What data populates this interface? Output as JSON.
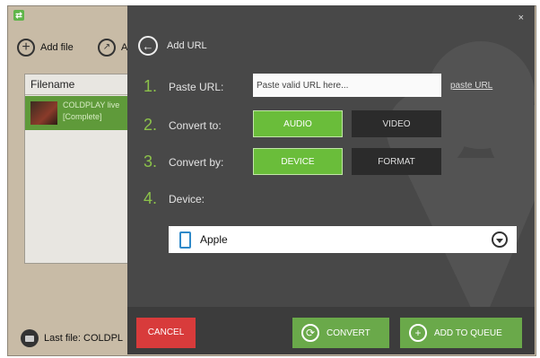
{
  "app": {
    "logo_glyph": "⇄",
    "toolbar": {
      "add_file_label": "Add file",
      "share_label": "A"
    },
    "file_list": {
      "header": "Filename",
      "items": [
        {
          "name": "COLDPLAY live",
          "status": "[Complete]"
        }
      ]
    },
    "footer": {
      "last_file_label": "Last file: COLDPL"
    }
  },
  "dialog": {
    "close_glyph": "×",
    "back_glyph": "←",
    "title": "Add URL",
    "steps": [
      {
        "number": "1.",
        "label": "Paste URL:"
      },
      {
        "number": "2.",
        "label": "Convert to:"
      },
      {
        "number": "3.",
        "label": "Convert by:"
      },
      {
        "number": "4.",
        "label": "Device:"
      }
    ],
    "url_input": {
      "value": "",
      "placeholder": "Paste valid URL here..."
    },
    "paste_url_link": "paste URL",
    "convert_to": {
      "options": [
        "AUDIO",
        "VIDEO"
      ],
      "selected": "AUDIO"
    },
    "convert_by": {
      "options": [
        "DEVICE",
        "FORMAT"
      ],
      "selected": "DEVICE"
    },
    "device": {
      "selected": "Apple",
      "icon": "phone-icon"
    },
    "footer": {
      "cancel_label": "CANCEL",
      "convert_label": "CONVERT",
      "add_to_queue_label": "ADD TO QUEUE"
    }
  },
  "colors": {
    "accent_green": "#6abd3a",
    "dialog_bg": "#484848",
    "cancel_red": "#d83b3b",
    "step_number_green": "#8cc24a"
  }
}
